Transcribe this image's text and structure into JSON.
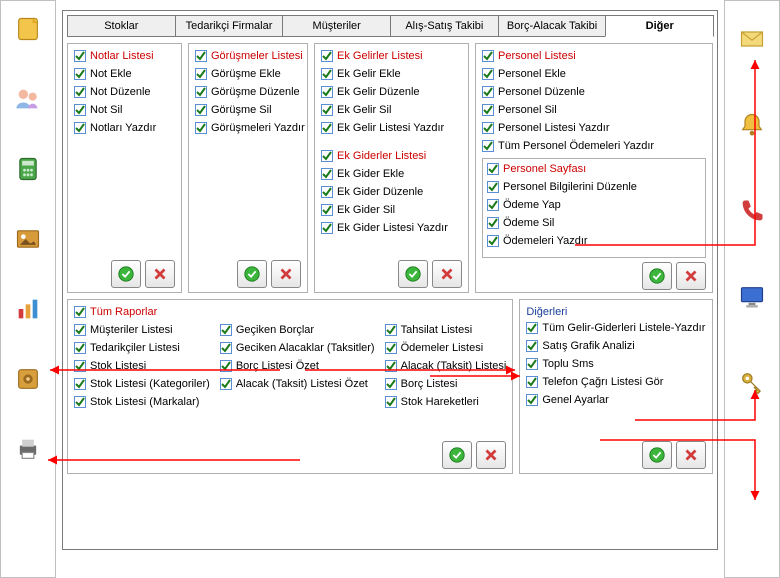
{
  "tabs": [
    "Stoklar",
    "Tedarikçi Firmalar",
    "Müşteriler",
    "Alış-Satış Takibi",
    "Borç-Alacak Takibi",
    "Diğer"
  ],
  "activeTab": 5,
  "panels": {
    "notlar": {
      "header": "Notlar Listesi",
      "items": [
        "Not Ekle",
        "Not Düzenle",
        "Not Sil",
        "Notları Yazdır"
      ]
    },
    "gorusmeler": {
      "header": "Görüşmeler Listesi",
      "items": [
        "Görüşme Ekle",
        "Görüşme Düzenle",
        "Görüşme Sil",
        "Görüşmeleri  Yazdır"
      ]
    },
    "ekgelir": {
      "header": "Ek Gelirler Listesi",
      "items": [
        "Ek Gelir Ekle",
        "Ek Gelir Düzenle",
        "Ek Gelir Sil",
        "Ek Gelir Listesi Yazdır"
      ]
    },
    "ekgider": {
      "header": "Ek Giderler Listesi",
      "items": [
        "Ek Gider Ekle",
        "Ek Gider Düzenle",
        "Ek Gider Sil",
        "Ek Gider Listesi Yazdır"
      ]
    },
    "personel": {
      "header": "Personel Listesi",
      "items": [
        "Personel Ekle",
        "Personel Düzenle",
        "Personel Sil",
        "Personel Listesi Yazdır",
        "Tüm Personel Ödemeleri Yazdır"
      ]
    },
    "personelSayfa": {
      "header": "Personel Sayfası",
      "items": [
        "Personel Bilgilerini Düzenle",
        "Ödeme Yap",
        "Ödeme Sil",
        "Ödemeleri Yazdır"
      ]
    },
    "raporlar": {
      "header": "Tüm Raporlar",
      "col1": [
        "Müşteriler Listesi",
        "Tedarikçiler Listesi",
        "Stok Listesi",
        "Stok Listesi (Kategoriler)",
        "Stok Listesi (Markalar)"
      ],
      "col2": [
        "Geçiken Borçlar",
        "Geciken Alacaklar (Taksitler)",
        "Borç Listesi Özet",
        "Alacak (Taksit) Listesi Özet"
      ],
      "col3": [
        "Tahsilat Listesi",
        "Ödemeler Listesi",
        "Alacak (Taksit)  Listesi",
        "Borç Listesi",
        "Stok Hareketleri"
      ]
    },
    "digerleri": {
      "label": "Diğerleri",
      "items": [
        "Tüm Gelir-Giderleri Listele-Yazdır",
        "Satış Grafik Analizi",
        "Toplu Sms",
        "Telefon Çağrı Listesi Gör",
        "Genel Ayarlar"
      ]
    }
  },
  "sidebar": {
    "left": [
      "note",
      "users",
      "calc",
      "image",
      "chart",
      "safe",
      "printer"
    ],
    "right": [
      "mail",
      "bell",
      "phone",
      "monitor",
      "key"
    ]
  }
}
